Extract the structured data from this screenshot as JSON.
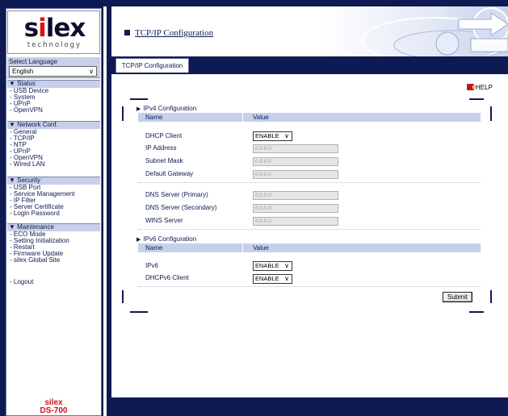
{
  "brand": {
    "logo_prefix": "s",
    "logo_dot": "i",
    "logo_suffix": "lex",
    "logo_sub": "technology",
    "model_line1": "silex",
    "model_line2": "DS-700",
    "accent_navy": "#0f1a52",
    "accent_light": "#c7d0ea",
    "brand_red": "#c61414"
  },
  "language": {
    "title": "Select Language",
    "selected": "English"
  },
  "sidebar": {
    "status": {
      "heading": "▼ Status",
      "items": [
        "- USB Device",
        "- System",
        "- UPnP",
        "- OpenVPN"
      ]
    },
    "network": {
      "heading": "▼ Network Conf.",
      "items": [
        "- General",
        "- TCP/IP",
        "- NTP",
        "- UPnP",
        "- OpenVPN",
        "- Wired LAN"
      ]
    },
    "security": {
      "heading": "▼ Security",
      "items": [
        "- USB Port",
        "- Service Management",
        "- IP Filter",
        "- Server Certificate",
        "- Login Password"
      ]
    },
    "maintenance": {
      "heading": "▼ Maintenance",
      "items": [
        "- ECO Mode",
        "- Setting Initialization",
        "- Restart",
        "- Firmware Update",
        "- silex Global Site"
      ]
    },
    "logout": "- Logout"
  },
  "header": {
    "title": "TCP/IP Configuration",
    "tab": "TCP/IP Configuration",
    "help": "HELP"
  },
  "ipv4": {
    "title": "IPv4 Configuration",
    "col_name": "Name",
    "col_value": "Value",
    "dhcp_label": "DHCP Client",
    "dhcp_value": "ENABLE",
    "ip_label": "IP Address",
    "ip_value": "0.0.0.0",
    "mask_label": "Subnet Mask",
    "mask_value": "0.0.0.0",
    "gw_label": "Default Gateway",
    "gw_value": "0.0.0.0",
    "dns1_label": "DNS Server (Primary)",
    "dns1_value": "0.0.0.0",
    "dns2_label": "DNS Server (Secondary)",
    "dns2_value": "0.0.0.0",
    "wins_label": "WINS Server",
    "wins_value": "0.0.0.0"
  },
  "ipv6": {
    "title": "IPv6 Configuration",
    "col_name": "Name",
    "col_value": "Value",
    "ipv6_label": "IPv6",
    "ipv6_value": "ENABLE",
    "dhcpv6_label": "DHCPv6 Client",
    "dhcpv6_value": "ENABLE"
  },
  "actions": {
    "submit": "Submit"
  }
}
